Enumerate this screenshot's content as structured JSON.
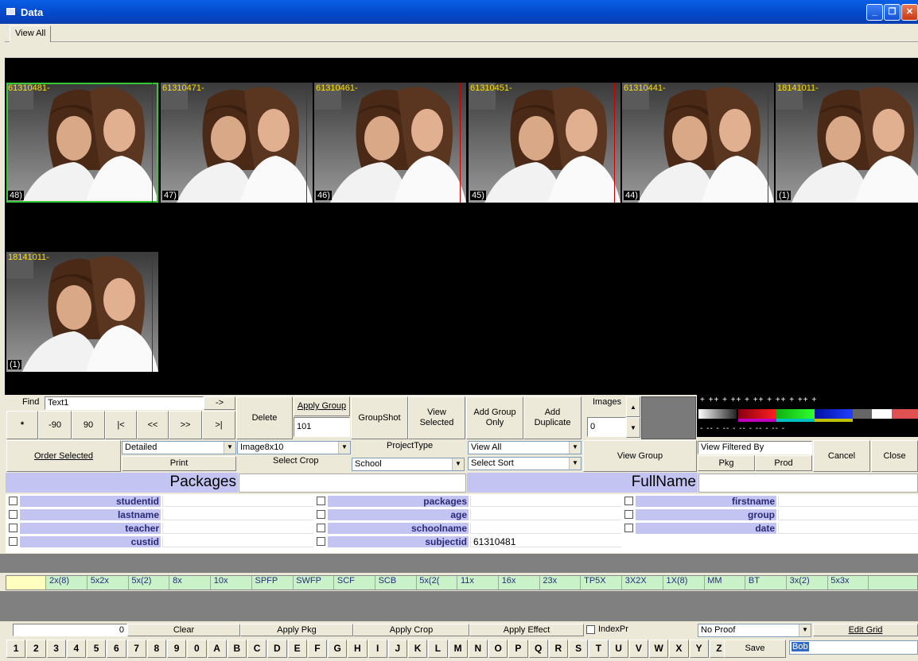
{
  "window": {
    "title": "Data",
    "minimize": "_",
    "restore": "❐",
    "close": "✕"
  },
  "tabs": [
    {
      "label": "View All"
    }
  ],
  "gallery": [
    {
      "id": "61310481-",
      "num": "48)",
      "selected": true
    },
    {
      "id": "61310471-",
      "num": "47)",
      "selected": false
    },
    {
      "id": "61310461-",
      "num": "46)",
      "selected": false
    },
    {
      "id": "61310451-",
      "num": "45)",
      "selected": false
    },
    {
      "id": "61310441-",
      "num": "44)",
      "selected": false
    },
    {
      "id": "18141011-",
      "num": "(1)",
      "selected": false
    },
    {
      "id": "18141011-",
      "num": "(1)",
      "selected": false
    }
  ],
  "find": {
    "label": "Find",
    "value": "Text1",
    "go": "->"
  },
  "nav": {
    "star": "*",
    "m90": "-90",
    "p90": "90",
    "first": "|<",
    "prev": "<<",
    "next": ">>",
    "last": ">|"
  },
  "actions": {
    "delete": "Delete",
    "apply_group": "Apply Group",
    "apply_group_value": "101",
    "groupshot": "GroupShot",
    "view_selected": "View Selected",
    "add_group_only": "Add Group Only",
    "add_duplicate": "Add Duplicate",
    "images_label": "Images",
    "images_value": "0",
    "order_selected": "Order Selected",
    "print_mode": "Detailed",
    "print": "Print",
    "crop_value": "Image8x10",
    "select_crop": "Select Crop",
    "project_type_label": "ProjectType",
    "project_type_value": "School",
    "view_value": "View All",
    "sort_value": "Select Sort",
    "view_group": "View Group",
    "view_filtered_by": "View Filtered By",
    "pkg": "Pkg",
    "prod": "Prod",
    "cancel": "Cancel",
    "close": "Close"
  },
  "color_strip": {
    "plus": "+ ++ + ++ + ++ + ++ + ++ +",
    "minus": "- -- - -- - -- - -- - -- -"
  },
  "headers": {
    "packages": "Packages",
    "fullname": "FullName"
  },
  "fields": [
    {
      "label": "studentid",
      "value": ""
    },
    {
      "label": "lastname",
      "value": ""
    },
    {
      "label": "teacher",
      "value": ""
    },
    {
      "label": "custid",
      "value": ""
    },
    {
      "label": "packages",
      "value": ""
    },
    {
      "label": "age",
      "value": ""
    },
    {
      "label": "schoolname",
      "value": ""
    },
    {
      "label": "subjectid",
      "value": "61310481"
    },
    {
      "label": "firstname",
      "value": ""
    },
    {
      "label": "group",
      "value": ""
    },
    {
      "label": "date",
      "value": ""
    }
  ],
  "packages": [
    "2x(8)",
    "5x2x",
    "5x(2)",
    "8x",
    "10x",
    "SPFP",
    "SWFP",
    "SCF",
    "SCB",
    "5x(2(",
    "11x",
    "16x",
    "23x",
    "TP5X",
    "3X2X",
    "1X(8)",
    "MM",
    "BT",
    "3x(2)",
    "5x3x"
  ],
  "bottom": {
    "count": "0",
    "clear": "Clear",
    "apply_pkg": "Apply Pkg",
    "apply_crop": "Apply Crop",
    "apply_effect": "Apply Effect",
    "index_pr": "IndexPr",
    "proof_value": "No Proof",
    "edit_grid": "Edit Grid",
    "save": "Save",
    "search_value": "Bob"
  },
  "alphabet": [
    "1",
    "2",
    "3",
    "4",
    "5",
    "6",
    "7",
    "8",
    "9",
    "0",
    "A",
    "B",
    "C",
    "D",
    "E",
    "F",
    "G",
    "H",
    "I",
    "J",
    "K",
    "L",
    "M",
    "N",
    "O",
    "P",
    "Q",
    "R",
    "S",
    "T",
    "U",
    "V",
    "W",
    "X",
    "Y",
    "Z"
  ]
}
